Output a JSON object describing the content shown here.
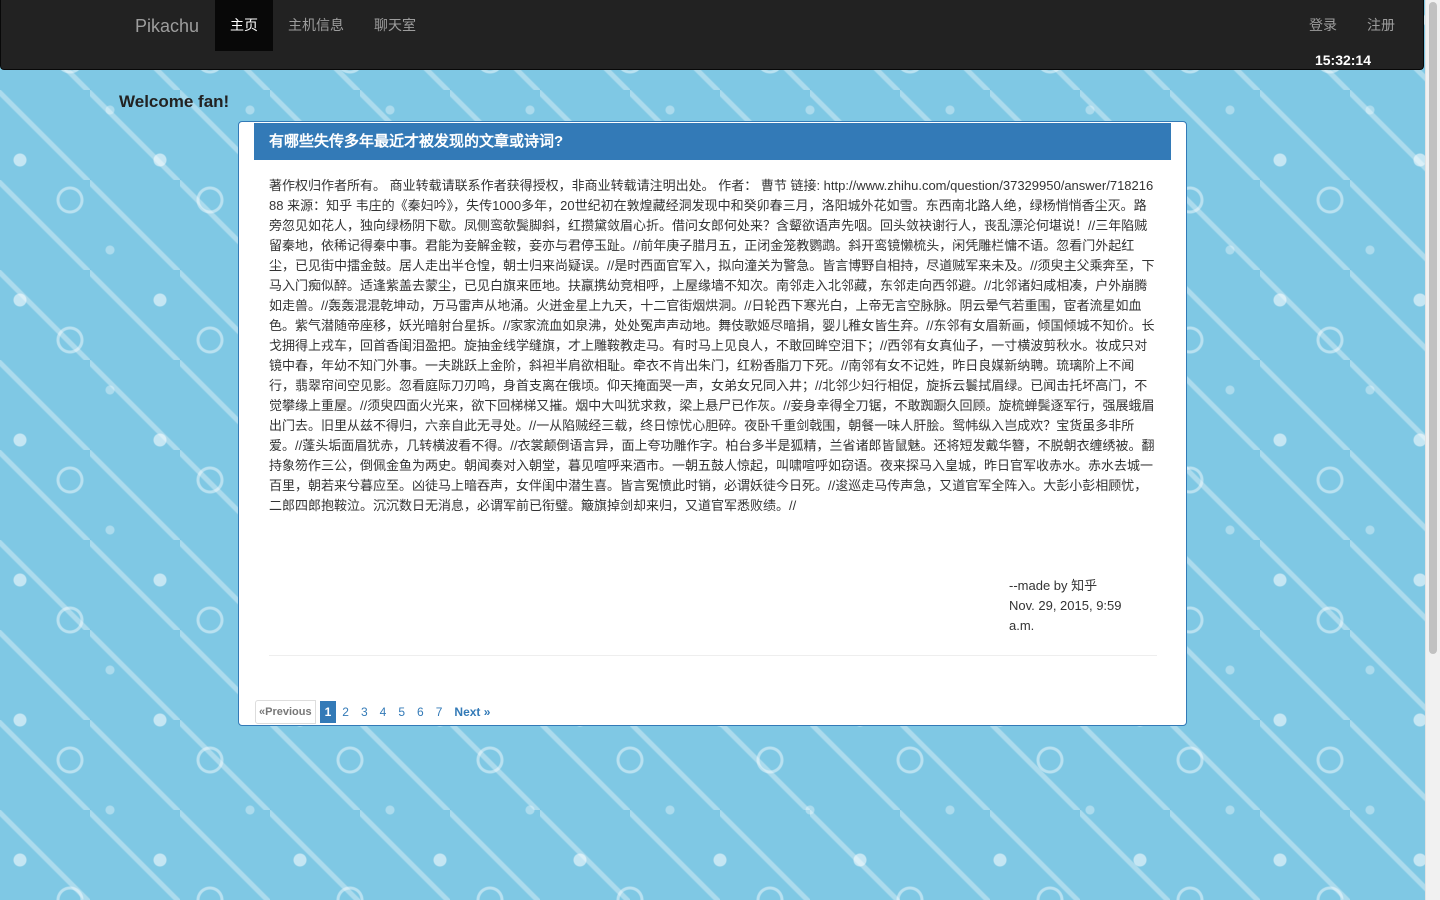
{
  "navbar": {
    "brand": "Pikachu",
    "items": [
      {
        "label": "主页",
        "active": true
      },
      {
        "label": "主机信息",
        "active": false
      },
      {
        "label": "聊天室",
        "active": false
      }
    ],
    "right_items": [
      {
        "label": "登录"
      },
      {
        "label": "注册"
      }
    ],
    "clock": "15:32:14"
  },
  "welcome": "Welcome fan!",
  "panel": {
    "title": "有哪些失传多年最近才被发现的文章或诗词?",
    "body": "著作权归作者所有。 商业转载请联系作者获得授权，非商业转载请注明出处。 作者： 曹节 链接: http://www.zhihu.com/question/37329950/answer/71821688 来源：知乎 韦庄的《秦妇吟》，失传1000多年，20世纪初在敦煌藏经洞发现中和癸卯春三月，洛阳城外花如雪。东西南北路人绝，绿杨悄悄香尘灭。路旁忽见如花人，独向绿杨阴下歇。凤侧鸾欹鬓脚斜，红攒黛敛眉心折。借问女郎何处来？含颦欲语声先咽。回头敛袂谢行人，丧乱漂沦何堪说！//三年陷贼留秦地，依稀记得秦中事。君能为妾解金鞍，妾亦与君停玉趾。//前年庚子腊月五，正闭金笼教鹦鹉。斜开鸾镜懒梳头，闲凭雕栏慵不语。忽看门外起红尘，已见街中擂金鼓。居人走出半仓惶，朝士归来尚疑误。//是时西面官军入，拟向潼关为警急。皆言博野自相持，尽道贼军来未及。//须臾主父乘奔至，下马入门痴似醉。适逢紫盖去蒙尘，已见白旗来匝地。扶羸携幼竞相呼，上屋缘墙不知次。南邻走入北邻藏，东邻走向西邻避。//北邻诸妇咸相凑，户外崩腾如走兽。//轰轰混混乾坤动，万马雷声从地涌。火迸金星上九天，十二官街烟烘洞。//日轮西下寒光白，上帝无言空脉脉。阴云晕气若重围，宦者流星如血色。紫气潜随帝座移，妖光暗射台星拆。//家家流血如泉沸，处处冤声声动地。舞伎歌姬尽暗捐，婴儿稚女皆生弃。//东邻有女眉新画，倾国倾城不知价。长戈拥得上戎车，回首香闺泪盈把。旋抽金线学缝旗，才上雕鞍教走马。有时马上见良人，不敢回眸空泪下；//西邻有女真仙子，一寸横波剪秋水。妆成只对镜中春，年幼不知门外事。一夫跳跃上金阶，斜袒半肩欲相耻。牵衣不肯出朱门，红粉香脂刀下死。//南邻有女不记姓，昨日良媒新纳聘。琉璃阶上不闻行，翡翠帘间空见影。忽看庭际刀刃鸣，身首支离在俄顷。仰天掩面哭一声，女弟女兄同入井；//北邻少妇行相促，旋拆云鬟拭眉绿。已闻击托坏高门，不觉攀缘上重屋。//须臾四面火光来，欲下回梯梯又摧。烟中大叫犹求救，梁上悬尸已作灰。//妾身幸得全刀锯，不敢踟蹰久回顾。旋梳蝉鬓逐军行，强展蛾眉出门去。旧里从兹不得归，六亲自此无寻处。//一从陷贼经三载，终日惊忧心胆碎。夜卧千重剑戟围，朝餐一味人肝脍。鸳帏纵入岂成欢？宝货虽多非所爱。//蓬头垢面眉犹赤，几转横波看不得。//衣裳颠倒语言异，面上夸功雕作字。柏台多半是狐精，兰省诸郎皆鼠魅。还将短发戴华簪，不脱朝衣缠绣被。翻持象笏作三公，倒佩金鱼为两史。朝闻奏对入朝堂，暮见喧呼来酒市。一朝五鼓人惊起，叫啸喧呼如窃语。夜来探马入皇城，昨日官军收赤水。赤水去城一百里，朝若来兮暮应至。凶徒马上暗吞声，女伴闺中潜生喜。皆言冤愤此时销，必谓妖徒今日死。//逡巡走马传声急，又道官军全阵入。大彭小彭相顾忧，二郎四郎抱鞍泣。沉沉数日无消息，必谓军前已衔璧。簸旗掉剑却来归，又道官军悉败绩。//",
    "meta_author": "--made by 知乎",
    "meta_date": "Nov. 29, 2015, 9:59 a.m."
  },
  "pagination": {
    "prev": "«Previous",
    "pages": [
      "1",
      "2",
      "3",
      "4",
      "5",
      "6",
      "7"
    ],
    "current": "1",
    "next": "Next »"
  },
  "colors": {
    "navbar_bg": "#222222",
    "panel_primary": "#337ab7",
    "background": "#7fc8e4"
  }
}
